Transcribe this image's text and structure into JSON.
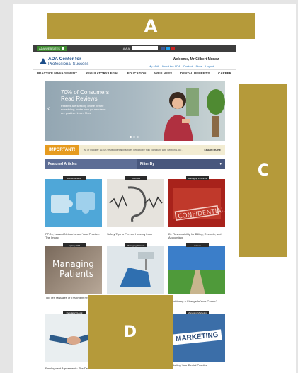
{
  "labels": {
    "a": "A",
    "c": "C",
    "d": "D"
  },
  "topbar": {
    "ada_websites": "ADA WEBSITES",
    "text_size": "A A A",
    "search_placeholder": "Search ADA.org"
  },
  "header": {
    "logo_line1": "ADA Center for",
    "logo_line2": "Professional Success",
    "welcome": "Welcome, Mr Gilbert Munoz",
    "links": [
      "My ADA",
      "About the ADA",
      "Contact",
      "Store",
      "Logout"
    ]
  },
  "nav": [
    "PRACTICE MANAGEMENT",
    "REGULATORY/LEGAL",
    "EDUCATION",
    "WELLNESS",
    "DENTAL BENEFITS",
    "CAREER"
  ],
  "hero": {
    "title_line1": "70% of Consumers",
    "title_line2": "Read Reviews",
    "desc": "Patients are seeking online before scheduling; make sure your reviews are positive. Learn More"
  },
  "important": {
    "tag": "IMPORTANT!",
    "text": "As of October 16, un-vested dental practices need to be fully compliant with Section 1557.",
    "more": "LEARN MORE"
  },
  "featured": {
    "title": "Featured Articles",
    "filter": "Filter By"
  },
  "cards": [
    {
      "tag": "Dental Benefits",
      "caption": "PPOs, Leased Networks and Your Practice: The Impact"
    },
    {
      "tag": "Wellness",
      "caption": "Safety Tips to Prevent Hearing Loss"
    },
    {
      "tag": "Managing Finances",
      "caption": "Dr. Responsibility for Billing, Records, and Accounting"
    },
    {
      "tag": "Spring 2017",
      "caption": "Top Ten Mistakes of Treatment Presentations",
      "thumb_text_1": "Managing",
      "thumb_text_2": "Patients"
    },
    {
      "tag": "Managing Patients",
      "caption": ""
    },
    {
      "tag": "Career",
      "caption": "Considering a Change In Your Career?"
    },
    {
      "tag": "Regulatory/Legal",
      "caption": "Employment Agreements: The Details"
    },
    {
      "tag": "Managing Marketing",
      "caption": "Marketing Your Dental Practice",
      "thumb_text_1": "MARKETING"
    }
  ],
  "colors": {
    "label_gold": "#b59a3a",
    "nav_dark": "#3d3d3d",
    "featured_bar": "#5d6d95",
    "important_orange": "#e69b1f"
  }
}
